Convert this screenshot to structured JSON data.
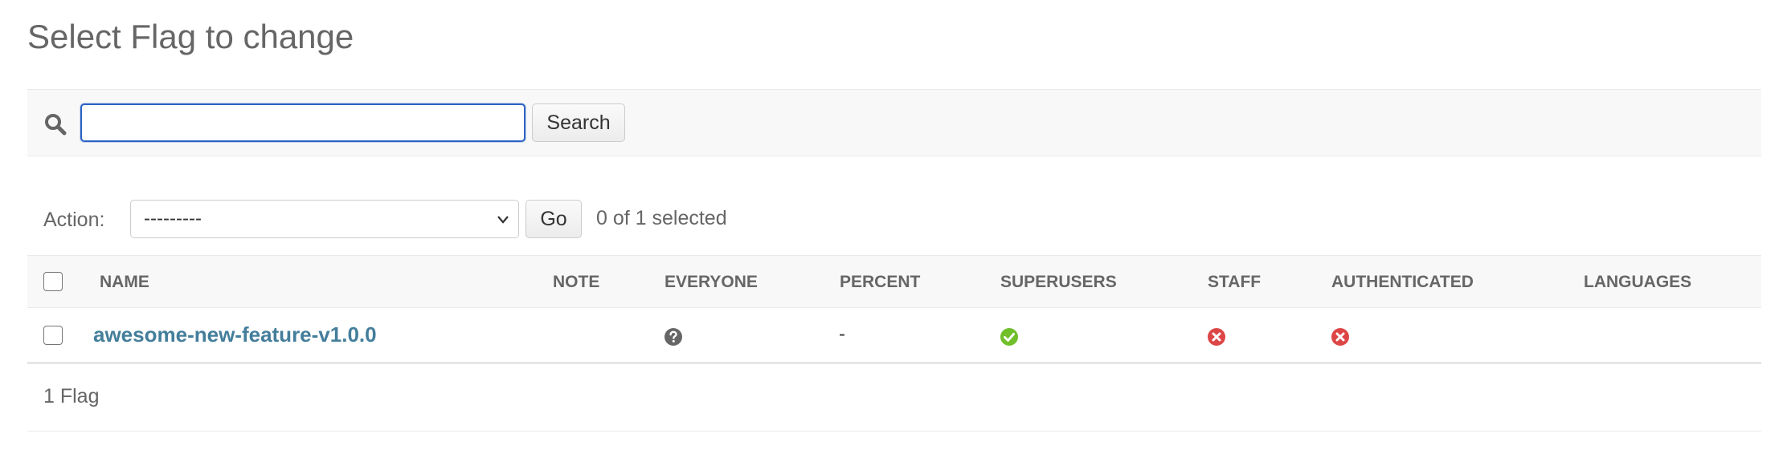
{
  "page": {
    "title": "Select Flag to change"
  },
  "search": {
    "value": "",
    "placeholder": "",
    "button_label": "Search",
    "icon": "search-icon"
  },
  "actions": {
    "label": "Action:",
    "selected_option": "---------",
    "go_label": "Go",
    "selection_counter": "0 of 1 selected"
  },
  "table": {
    "columns": [
      "NAME",
      "NOTE",
      "EVERYONE",
      "PERCENT",
      "SUPERUSERS",
      "STAFF",
      "AUTHENTICATED",
      "LANGUAGES"
    ],
    "rows": [
      {
        "selected": false,
        "name": "awesome-new-feature-v1.0.0",
        "note": "",
        "everyone": "unknown-icon",
        "percent": "-",
        "superusers": "yes-icon",
        "staff": "no-icon",
        "authenticated": "no-icon",
        "languages": ""
      }
    ]
  },
  "paginator": {
    "text": "1 Flag"
  },
  "colors": {
    "link": "#447e9b",
    "yes": "#70bf2b",
    "no": "#dd4646",
    "unknown": "#666666",
    "focus": "#2b63c4"
  }
}
